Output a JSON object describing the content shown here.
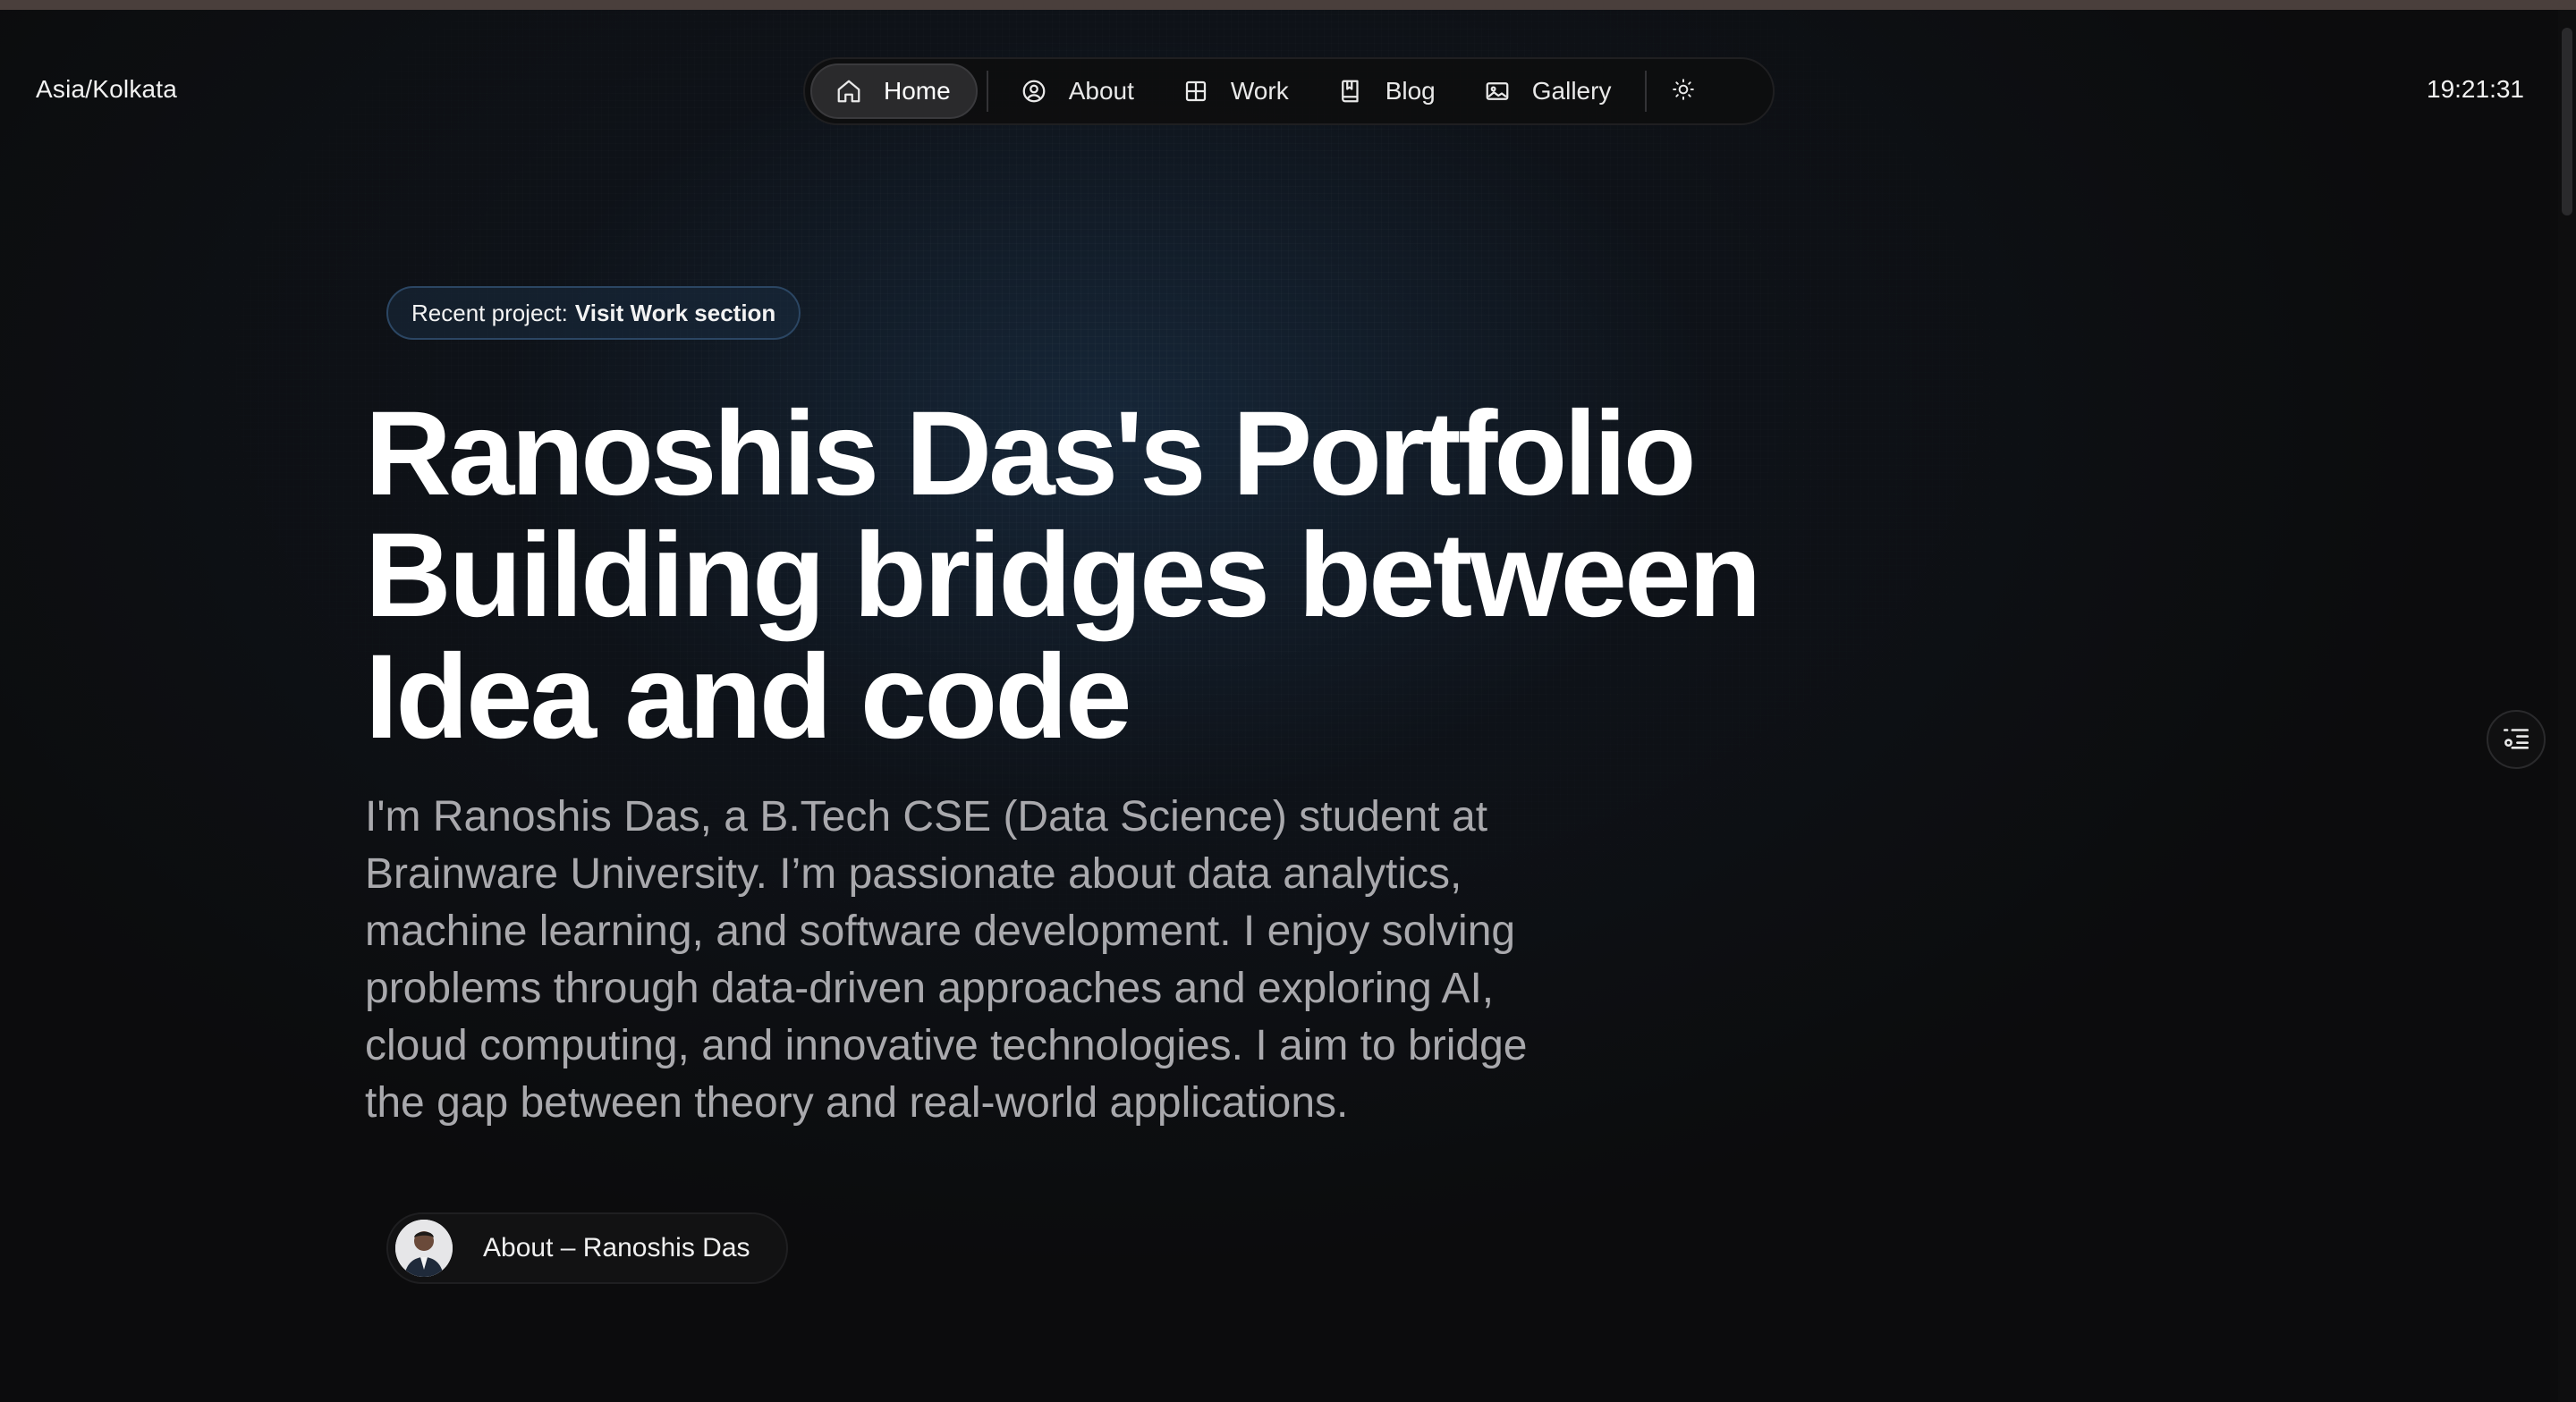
{
  "header": {
    "timezone": "Asia/Kolkata",
    "time": "19:21:31"
  },
  "nav": {
    "items": [
      {
        "label": "Home",
        "icon": "home-icon",
        "active": true
      },
      {
        "label": "About",
        "icon": "user-circle-icon",
        "active": false
      },
      {
        "label": "Work",
        "icon": "grid-icon",
        "active": false
      },
      {
        "label": "Blog",
        "icon": "book-icon",
        "active": false
      },
      {
        "label": "Gallery",
        "icon": "image-icon",
        "active": false
      }
    ],
    "theme_toggle_icon": "sun-icon"
  },
  "hero": {
    "badge_prefix": "Recent project:",
    "badge_link": "Visit Work section",
    "headline_bold": "Ranoshis Das's Portfolio",
    "headline_regular": "Building bridges between Idea and code",
    "description": "I'm Ranoshis Das, a B.Tech CSE (Data Science) student at Brainware University. I’m passionate about data analytics, machine learning, and software development. I enjoy solving problems through data-driven approaches and exploring AI, cloud computing, and innovative technologies. I aim to bridge the gap between theory and real-world applications.",
    "about_button_label": "About – Ranoshis Das"
  },
  "side": {
    "toc_icon": "table-of-contents-icon"
  },
  "colors": {
    "background": "#0c0c0d",
    "badge_border": "#2b4663",
    "text_muted": "#a9a9ad",
    "nav_active_bg": "#2a2a2c"
  }
}
